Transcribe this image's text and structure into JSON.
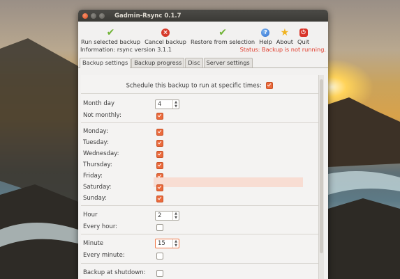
{
  "window": {
    "title": "Gadmin-Rsync 0.1.7"
  },
  "toolbar": {
    "run_label": "Run selected backup",
    "cancel_label": "Cancel backup",
    "restore_label": "Restore from selection",
    "help_label": "Help",
    "about_label": "About",
    "quit_label": "Quit"
  },
  "info": {
    "information": "Information: rsync  version 3.1.1",
    "status": "Status: Backup is not running."
  },
  "tabs": [
    "Backup settings",
    "Backup progress",
    "Disc",
    "Server settings"
  ],
  "schedule": {
    "label": "Schedule this backup to run at specific times:",
    "checked": true
  },
  "fields": {
    "month_day_label": "Month day",
    "month_day_value": "4",
    "not_monthly_label": "Not monthly:",
    "monday": "Monday:",
    "tuesday": "Tuesday:",
    "wednesday": "Wednesday:",
    "thursday": "Thursday:",
    "friday": "Friday:",
    "saturday": "Saturday:",
    "sunday": "Sunday:",
    "hour_label": "Hour",
    "hour_value": "2",
    "every_hour_label": "Every hour:",
    "minute_label": "Minute",
    "minute_value": "15",
    "every_minute_label": "Every minute:",
    "backup_shutdown_label": "Backup at shutdown:"
  },
  "icons": {
    "run": "check-icon",
    "cancel": "cancel-icon",
    "restore": "check-icon",
    "help": "help-icon",
    "about": "star-icon",
    "quit": "power-icon"
  },
  "colors": {
    "status_red": "#e03a2a",
    "checkbox_orange": "#eb6a3c",
    "highlight_row": "#f8ddd3",
    "titlebar": "#3b3a36"
  }
}
